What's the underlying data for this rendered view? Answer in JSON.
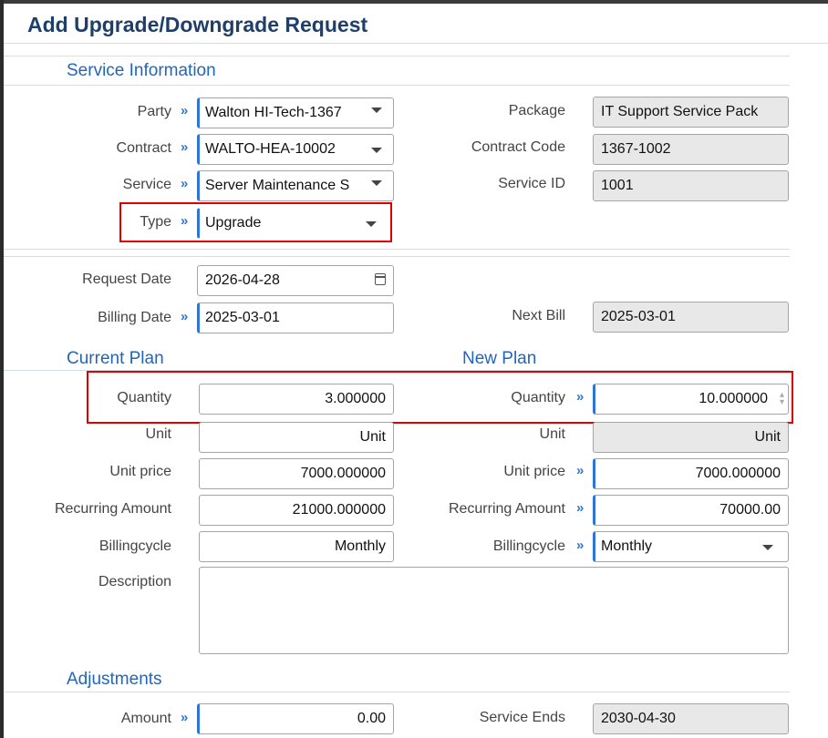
{
  "title": "Add Upgrade/Downgrade Request",
  "sections": {
    "service_information": "Service Information",
    "current_plan": "Current Plan",
    "new_plan": "New Plan",
    "adjustments": "Adjustments"
  },
  "arrow_glyph": "»",
  "service": {
    "party_label": "Party",
    "party_value": "Walton HI-Tech-1367",
    "contract_label": "Contract",
    "contract_value": "WALTO-HEA-10002",
    "service_label": "Service",
    "service_value": "Server Maintenance S",
    "type_label": "Type",
    "type_value": "Upgrade",
    "package_label": "Package",
    "package_value": "IT Support Service Pack",
    "contract_code_label": "Contract Code",
    "contract_code_value": "1367-1002",
    "service_id_label": "Service ID",
    "service_id_value": "1001"
  },
  "dates": {
    "request_date_label": "Request Date",
    "request_date_value": "2026-04-28",
    "billing_date_label": "Billing Date",
    "billing_date_value": "2025-03-01",
    "next_bill_label": "Next Bill",
    "next_bill_value": "2025-03-01"
  },
  "current_plan": {
    "quantity_label": "Quantity",
    "quantity_value": "3.000000",
    "unit_label": "Unit",
    "unit_value": "Unit",
    "unit_price_label": "Unit price",
    "unit_price_value": "7000.000000",
    "recurring_label": "Recurring Amount",
    "recurring_value": "21000.000000",
    "billingcycle_label": "Billingcycle",
    "billingcycle_value": "Monthly",
    "description_label": "Description",
    "description_value": ""
  },
  "new_plan": {
    "quantity_label": "Quantity",
    "quantity_value": "10.000000",
    "unit_label": "Unit",
    "unit_value": "Unit",
    "unit_price_label": "Unit price",
    "unit_price_value": "7000.000000",
    "recurring_label": "Recurring Amount",
    "recurring_value": "70000.00",
    "billingcycle_label": "Billingcycle",
    "billingcycle_value": "Monthly"
  },
  "adjustments": {
    "amount_label": "Amount",
    "amount_value": "0.00",
    "service_ends_label": "Service Ends",
    "service_ends_value": "2030-04-30"
  },
  "colors": {
    "title": "#1f3f6b",
    "section": "#2266bb",
    "required_accent": "#2f76d2",
    "highlight": "#e00000",
    "readonly_bg": "#e8e8e8"
  }
}
